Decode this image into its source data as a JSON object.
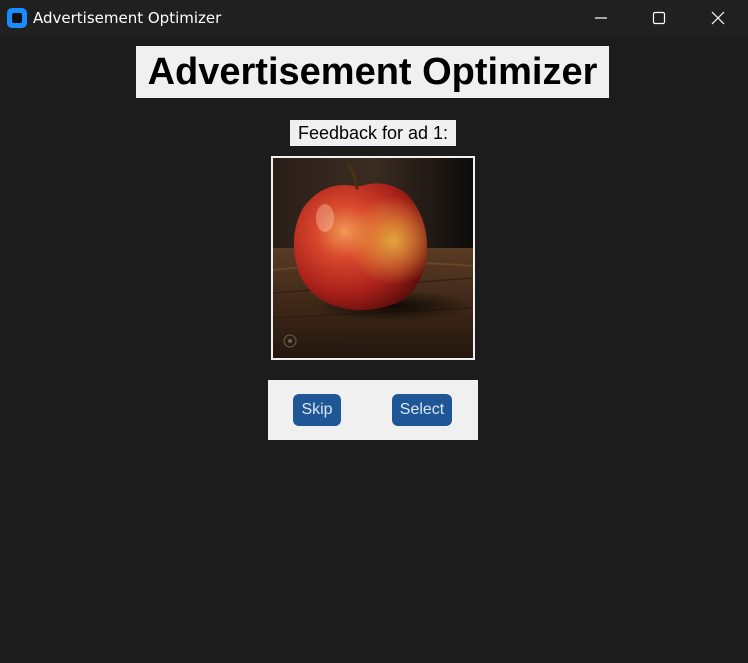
{
  "window": {
    "title": "Advertisement Optimizer",
    "icon": "app-icon",
    "controls": [
      "minimize-icon",
      "maximize-icon",
      "close-icon"
    ]
  },
  "main": {
    "heading": "Advertisement Optimizer",
    "feedback_label": "Feedback for ad 1:",
    "ad_image": {
      "subject": "apple-image",
      "alt": "Red apple on a wooden table"
    },
    "buttons": {
      "skip_label": "Skip",
      "select_label": "Select"
    }
  },
  "colors": {
    "background": "#1c1c1c",
    "titlebar": "#202020",
    "panel": "#f0f0f0",
    "button": "#1f5796",
    "button_text": "#dce6f2",
    "app_icon": "#1a8cff"
  }
}
